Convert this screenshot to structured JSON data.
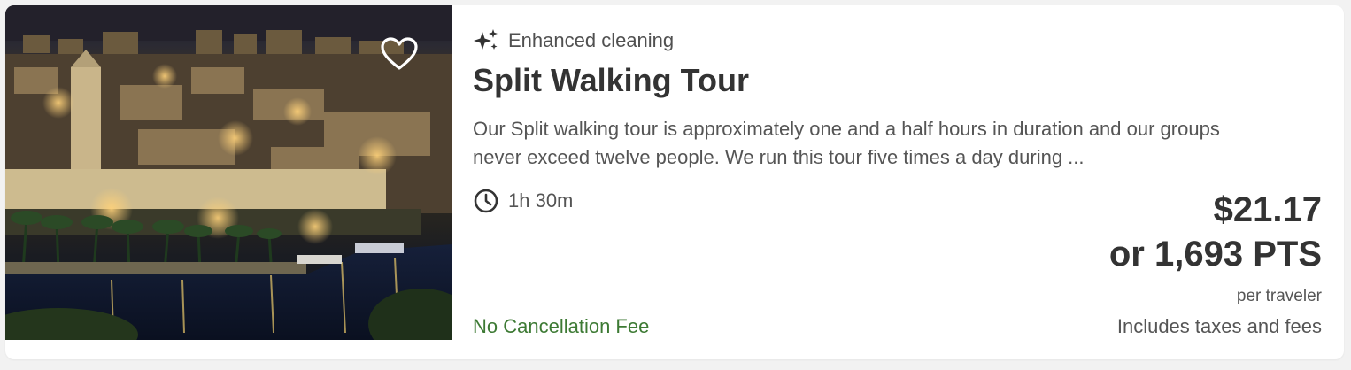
{
  "listing": {
    "badge_label": "Enhanced cleaning",
    "badge_icon": "sparkles-icon",
    "title": "Split Walking Tour",
    "description": "Our Split walking tour is approximately one and a half hours in duration and our groups never exceed twelve people. We run this tour five times a day during ...",
    "duration": "1h 30m",
    "duration_icon": "clock-icon",
    "cancellation": "No Cancellation Fee",
    "favorite_icon": "heart-outline-icon"
  },
  "price": {
    "amount": "$21.17",
    "points": "or 1,693 PTS",
    "unit": "per traveler",
    "taxes_note": "Includes taxes and fees"
  },
  "colors": {
    "title": "#333333",
    "body_text": "#555555",
    "cancellation_green": "#3d7a34",
    "card_background": "#ffffff",
    "page_background": "#f2f2f2"
  }
}
